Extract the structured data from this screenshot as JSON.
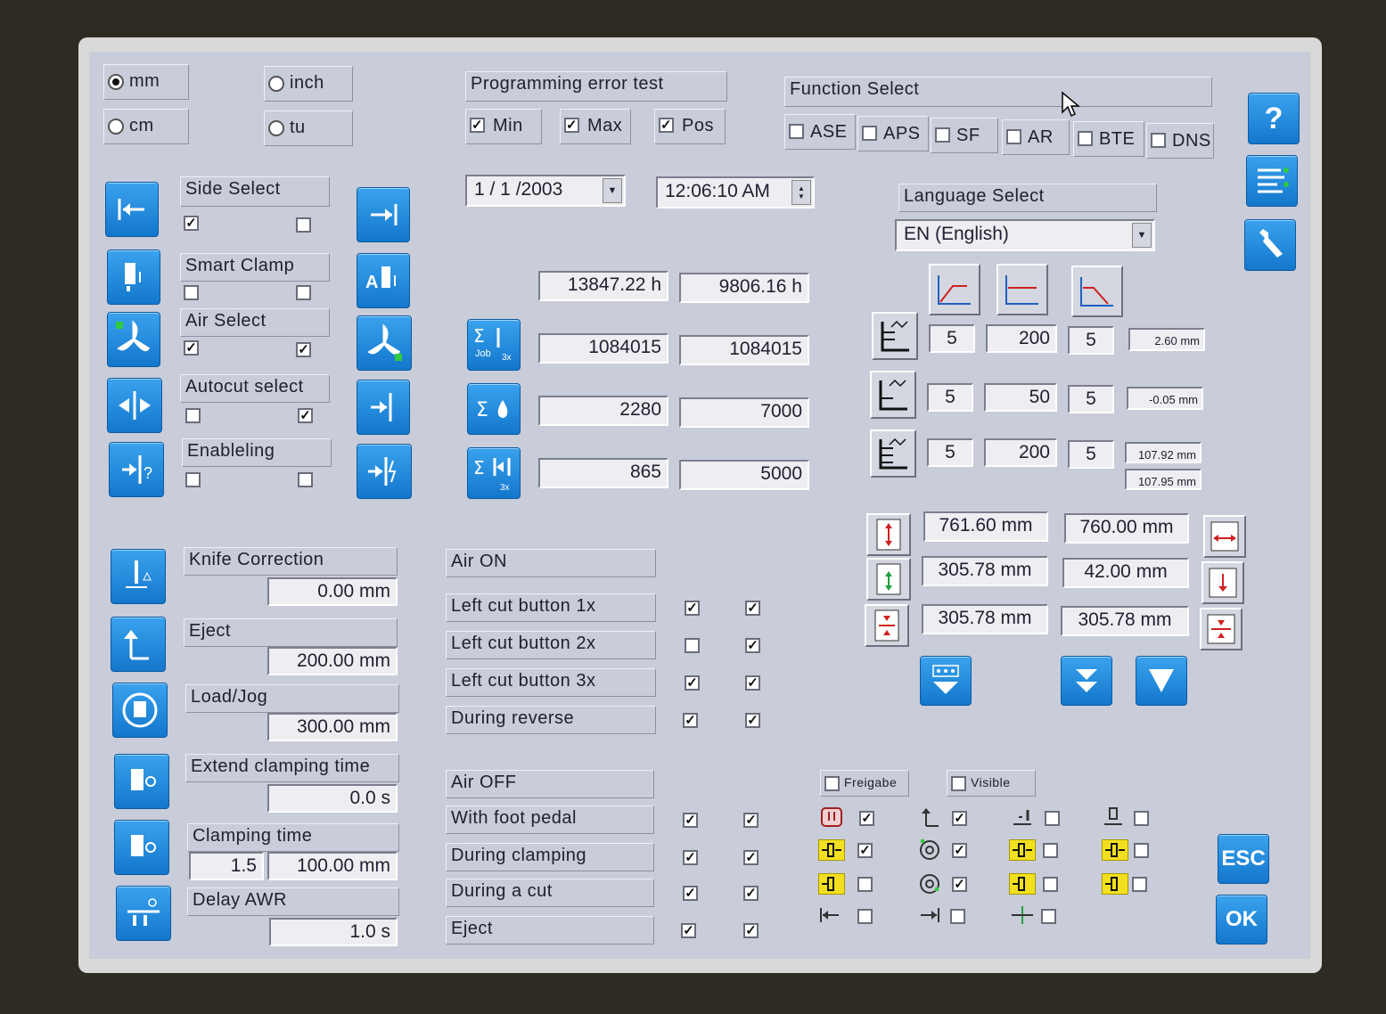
{
  "units": {
    "mm": "mm",
    "inch": "inch",
    "cm": "cm",
    "tu": "tu",
    "selected": "mm"
  },
  "prog_error": {
    "title": "Programming error test",
    "min": "Min",
    "max": "Max",
    "pos": "Pos"
  },
  "function_select": {
    "title": "Function Select",
    "ase": "ASE",
    "aps": "APS",
    "sf": "SF",
    "ar": "AR",
    "bte": "BTE",
    "dns": "DNS"
  },
  "date": "1 / 1 /2003",
  "time": "12:06:10 AM",
  "language": {
    "title": "Language Select",
    "selected": "EN (English)"
  },
  "left_groups": {
    "side_select": "Side Select",
    "smart_clamp": "Smart Clamp",
    "air_select": "Air Select",
    "autocut": "Autocut select",
    "enabling": "Enableling"
  },
  "hours": {
    "a": "13847.22 h",
    "b": "9806.16 h"
  },
  "counters": [
    {
      "a": "1084015",
      "b": "1084015"
    },
    {
      "a": "2280",
      "b": "7000"
    },
    {
      "a": "865",
      "b": "5000"
    }
  ],
  "ramps": [
    {
      "a": "5",
      "b": "200",
      "c": "5",
      "info": "2.60 mm"
    },
    {
      "a": "5",
      "b": "50",
      "c": "5",
      "info": "-0.05 mm"
    },
    {
      "a": "5",
      "b": "200",
      "c": "5",
      "info": "107.92 mm",
      "info2": "107.95 mm"
    }
  ],
  "dims": [
    {
      "a": "761.60 mm",
      "b": "760.00 mm"
    },
    {
      "a": "305.78 mm",
      "b": "42.00 mm"
    },
    {
      "a": "305.78 mm",
      "b": "305.78 mm"
    }
  ],
  "settings": {
    "knife_correction": {
      "label": "Knife Correction",
      "value": "0.00 mm"
    },
    "eject": {
      "label": "Eject",
      "value": "200.00 mm"
    },
    "load_jog": {
      "label": "Load/Jog",
      "value": "300.00 mm"
    },
    "extend_clamping": {
      "label": "Extend clamping time",
      "value": "0.0 s"
    },
    "clamping_time": {
      "label": "Clamping time",
      "value1": "1.5",
      "value2": "100.00 mm"
    },
    "delay_awr": {
      "label": "Delay AWR",
      "value": "1.0 s"
    }
  },
  "air_on": {
    "title": "Air ON",
    "rows": [
      "Left cut button 1x",
      "Left cut button 2x",
      "Left cut button 3x",
      "During reverse"
    ]
  },
  "air_off": {
    "title": "Air OFF",
    "rows": [
      "With foot pedal",
      "During clamping",
      "During a cut",
      "Eject"
    ]
  },
  "freigabe": "Freigabe",
  "visible": "Visible",
  "buttons": {
    "help": "?",
    "esc": "ESC",
    "ok": "OK"
  },
  "colors": {
    "accent": "#1a8ae0",
    "screen": "#c9ccd9",
    "yellow": "#f2e020"
  }
}
